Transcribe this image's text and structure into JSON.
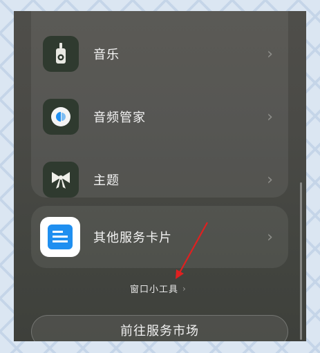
{
  "items": [
    {
      "label": "音乐",
      "icon": "music-player-icon"
    },
    {
      "label": "音频管家",
      "icon": "audio-manager-icon"
    },
    {
      "label": "主题",
      "icon": "bow-theme-icon"
    }
  ],
  "other_card": {
    "label": "其他服务卡片",
    "icon": "service-card-icon"
  },
  "widget_link": {
    "label": "窗口小工具"
  },
  "market_button": {
    "label": "前往服务市场"
  },
  "chevron": "›",
  "colors": {
    "annotation_arrow": "#e02020",
    "accent_blue": "#1f8ff0",
    "icon_bg": "#2f3a2f"
  }
}
